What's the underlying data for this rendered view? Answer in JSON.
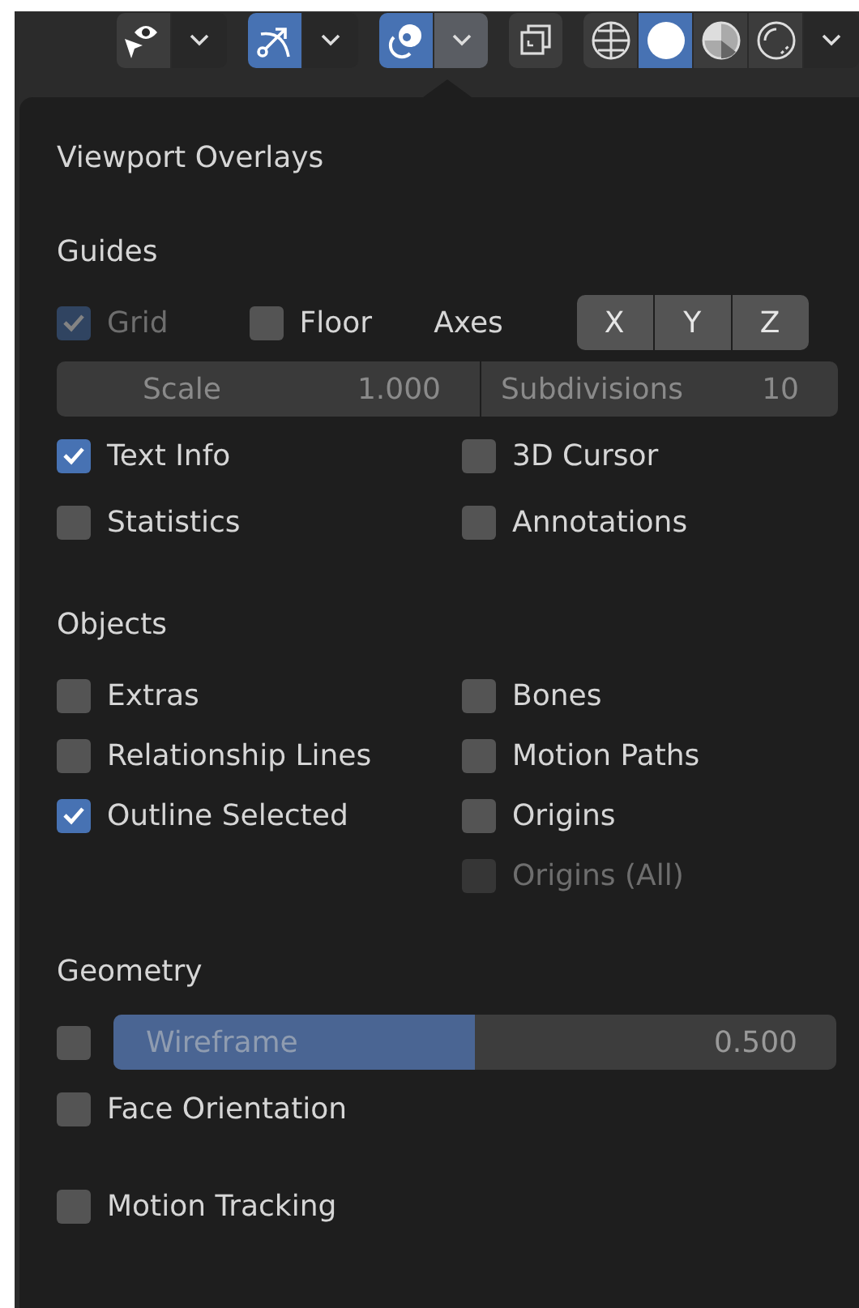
{
  "toolbar": [
    {
      "buttons": [
        {
          "kind": "visibility",
          "selected": false
        },
        {
          "kind": "dropdown",
          "selected": false
        }
      ]
    },
    {
      "buttons": [
        {
          "kind": "gizmo",
          "selected": true
        },
        {
          "kind": "dropdown",
          "selected": false
        }
      ]
    },
    {
      "buttons": [
        {
          "kind": "overlays",
          "selected": true
        },
        {
          "kind": "dropdown",
          "selected": true
        }
      ]
    },
    {
      "buttons": [
        {
          "kind": "xray",
          "selected": false
        }
      ]
    },
    {
      "buttons": [
        {
          "kind": "wireframe",
          "selected": false
        },
        {
          "kind": "solid",
          "selected": true
        },
        {
          "kind": "material",
          "selected": false
        },
        {
          "kind": "rendered",
          "selected": false
        },
        {
          "kind": "dropdown",
          "selected": false
        }
      ]
    }
  ],
  "popover": {
    "title": "Viewport Overlays",
    "sections": [
      {
        "title": "Guides",
        "rows": [
          {
            "kind": "grid",
            "items": [
              {
                "label": "Grid",
                "checked": true,
                "disabled": true
              },
              {
                "label": "Floor",
                "checked": false,
                "disabled": false
              }
            ],
            "axes_label": "Axes",
            "axes": [
              {
                "label": "X",
                "selected": false
              },
              {
                "label": "Y",
                "selected": false
              },
              {
                "label": "Z",
                "selected": false
              }
            ]
          },
          {
            "kind": "fields",
            "disabled": true,
            "fields": [
              {
                "label": "Scale",
                "value": "1.000"
              },
              {
                "label": "Subdivisions",
                "value": "10"
              }
            ]
          },
          {
            "kind": "columns",
            "left": [
              {
                "label": "Text Info",
                "checked": true,
                "disabled": false
              },
              {
                "label": "Statistics",
                "checked": false,
                "disabled": false
              }
            ],
            "right": [
              {
                "label": "3D Cursor",
                "checked": false,
                "disabled": false
              },
              {
                "label": "Annotations",
                "checked": false,
                "disabled": false
              }
            ]
          }
        ]
      },
      {
        "title": "Objects",
        "rows": [
          {
            "kind": "columns",
            "left": [
              {
                "label": "Extras",
                "checked": false,
                "disabled": false
              },
              {
                "label": "Relationship Lines",
                "checked": false,
                "disabled": false
              },
              {
                "label": "Outline Selected",
                "checked": true,
                "disabled": false
              }
            ],
            "right": [
              {
                "label": "Bones",
                "checked": false,
                "disabled": false
              },
              {
                "label": "Motion Paths",
                "checked": false,
                "disabled": false
              },
              {
                "label": "Origins",
                "checked": false,
                "disabled": false
              },
              {
                "label": "Origins (All)",
                "checked": false,
                "disabled": true
              }
            ]
          }
        ]
      },
      {
        "title": "Geometry",
        "rows": [
          {
            "kind": "slider",
            "checked": false,
            "label": "Wireframe",
            "value": "0.500",
            "level": 0.5
          },
          {
            "kind": "check",
            "label": "Face Orientation",
            "checked": false,
            "disabled": false
          }
        ]
      },
      {
        "rows": [
          {
            "kind": "check",
            "label": "Motion Tracking",
            "checked": false,
            "disabled": false
          }
        ]
      }
    ]
  }
}
